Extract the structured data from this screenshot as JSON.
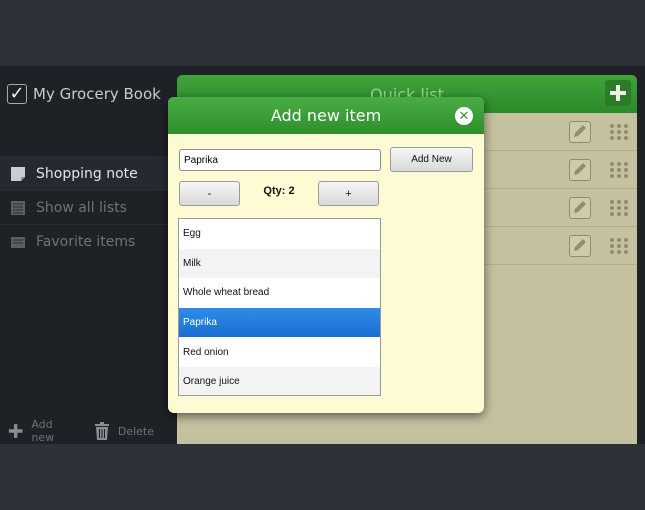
{
  "app": {
    "title": "My Grocery Book"
  },
  "sidebar": {
    "items": [
      {
        "label": "Shopping note",
        "active": true
      },
      {
        "label": "Show all lists",
        "active": false
      },
      {
        "label": "Favorite items",
        "active": false
      }
    ],
    "actions": {
      "add_label": "Add new",
      "delete_label": "Delete"
    }
  },
  "panel": {
    "title": "Quick list",
    "row_count": 4
  },
  "dialog": {
    "title": "Add new item",
    "input_value": "Paprika",
    "add_button": "Add New",
    "minus_label": "-",
    "plus_label": "+",
    "qty_text": "Qty: 2",
    "suggestions": [
      "Egg",
      "Milk",
      "Whole wheat bread",
      "Paprika",
      "Red onion",
      "Orange juice"
    ],
    "selected_index": 3
  },
  "colors": {
    "accent": "#3fa43a",
    "selection": "#1a6fd0",
    "dialog_bg": "#fdfbd4"
  },
  "icons": [
    "check-icon",
    "note-icon",
    "list-icon",
    "favorite-icon",
    "plus-icon",
    "trash-icon",
    "close-icon",
    "edit-icon",
    "grip-icon"
  ]
}
